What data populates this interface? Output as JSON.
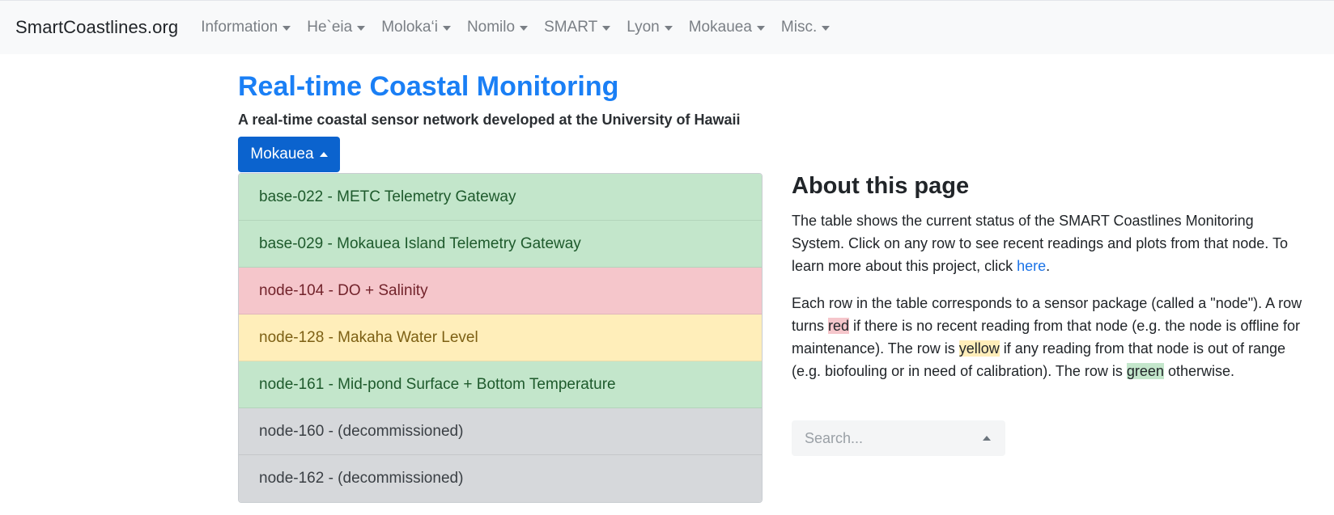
{
  "navbar": {
    "brand": "SmartCoastlines.org",
    "items": [
      {
        "label": "Information"
      },
      {
        "label": "He`eia"
      },
      {
        "label": "Moloka‘i"
      },
      {
        "label": "Nomilo"
      },
      {
        "label": "SMART"
      },
      {
        "label": "Lyon"
      },
      {
        "label": "Mokauea"
      },
      {
        "label": "Misc."
      }
    ]
  },
  "header": {
    "title": "Real-time Coastal Monitoring",
    "subtitle": "A real-time coastal sensor network developed at the University of Hawaii"
  },
  "dropdown": {
    "label": "Mokauea",
    "items": [
      {
        "label": "base-022 - METC Telemetry Gateway",
        "status": "green"
      },
      {
        "label": "base-029 - Mokauea Island Telemetry Gateway",
        "status": "green"
      },
      {
        "label": "node-104 - DO + Salinity",
        "status": "red"
      },
      {
        "label": "node-128 - Makaha Water Level",
        "status": "yellow"
      },
      {
        "label": "node-161 - Mid-pond Surface + Bottom Temperature",
        "status": "green"
      },
      {
        "label": "node-160 - (decommissioned)",
        "status": "gray"
      },
      {
        "label": "node-162 - (decommissioned)",
        "status": "gray"
      }
    ]
  },
  "about": {
    "title": "About this page",
    "p1_text": "The table shows the current status of the SMART Coastlines Monitoring System. Click on any row to see recent readings and plots from that node. To learn more about this project, click ",
    "p1_link": "here",
    "p1_end": ".",
    "p2_a": "Each row in the table corresponds to a sensor package (called a \"node\"). A row turns ",
    "p2_red": "red",
    "p2_b": " if there is no recent reading from that node (e.g. the node is offline for maintenance). The row is ",
    "p2_yellow": "yellow",
    "p2_c": " if any reading from that node is out of range (e.g. biofouling or in need of calibration). The row is ",
    "p2_green": "green",
    "p2_d": " otherwise."
  },
  "search": {
    "placeholder": "Search..."
  },
  "colors": {
    "primary": "#0b63ce",
    "title": "#1a7ff5",
    "green": "#c3e6cb",
    "red": "#f5c6cb",
    "yellow": "#ffeeba",
    "gray": "#d6d8db"
  }
}
